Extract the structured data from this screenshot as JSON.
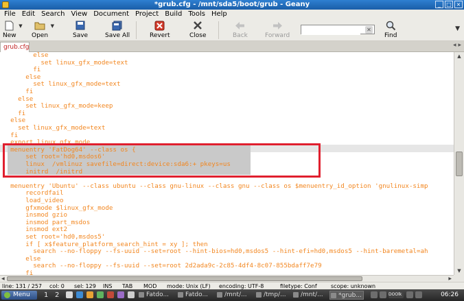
{
  "window": {
    "title": "*grub.cfg - /mnt/sda5/boot/grub - Geany",
    "buttons": [
      "_",
      "□",
      "×"
    ]
  },
  "menu": [
    "File",
    "Edit",
    "Search",
    "View",
    "Document",
    "Project",
    "Build",
    "Tools",
    "Help"
  ],
  "toolbar": {
    "new": "New",
    "open": "Open",
    "save": "Save",
    "save_all": "Save All",
    "revert": "Revert",
    "close": "Close",
    "back": "Back",
    "forward": "Forward",
    "search_value": "",
    "find": "Find"
  },
  "tabs": [
    {
      "label": "grub.cfg"
    }
  ],
  "editor": {
    "lines": [
      {
        "indent": "        ",
        "text": "else"
      },
      {
        "indent": "          ",
        "text": "set linux_gfx_mode=text"
      },
      {
        "indent": "        ",
        "text": "fi"
      },
      {
        "indent": "      ",
        "text": "else"
      },
      {
        "indent": "        ",
        "text": "set linux_gfx_mode=text"
      },
      {
        "indent": "      ",
        "text": "fi"
      },
      {
        "indent": "    ",
        "text": "else"
      },
      {
        "indent": "      ",
        "text": "set linux_gfx_mode=keep"
      },
      {
        "indent": "    ",
        "text": "fi"
      },
      {
        "indent": "  ",
        "text": "else"
      },
      {
        "indent": "    ",
        "text": "set linux_gfx_mode=text"
      },
      {
        "indent": "  ",
        "text": "fi"
      },
      {
        "indent": "  ",
        "text": "export linux_gfx_mode"
      },
      {
        "indent": "  ",
        "text": "menuentry 'FatDog64' --class os {"
      },
      {
        "indent": "      ",
        "text": "set root='hd0,msdos6'"
      },
      {
        "indent": "      ",
        "text": "linux  /vmlinuz savefile=direct:device:sda6:+ pkeys=us"
      },
      {
        "indent": "      ",
        "text": "initrd  /initrd"
      },
      {
        "indent": "",
        "text": ""
      },
      {
        "indent": "  ",
        "text": "menuentry 'Ubuntu' --class ubuntu --class gnu-linux --class gnu --class os $menuentry_id_option 'gnulinux-simp"
      },
      {
        "indent": "      ",
        "text": "recordfail"
      },
      {
        "indent": "      ",
        "text": "load_video"
      },
      {
        "indent": "      ",
        "text": "gfxmode $linux_gfx_mode"
      },
      {
        "indent": "      ",
        "text": "insmod gzio"
      },
      {
        "indent": "      ",
        "text": "insmod part_msdos"
      },
      {
        "indent": "      ",
        "text": "insmod ext2"
      },
      {
        "indent": "      ",
        "text": "set root='hd0,msdos5'"
      },
      {
        "indent": "      ",
        "text": "if [ x$feature_platform_search_hint = xy ]; then"
      },
      {
        "indent": "        ",
        "text": "search --no-floppy --fs-uuid --set=root --hint-bios=hd0,msdos5 --hint-efi=hd0,msdos5 --hint-baremetal=ah"
      },
      {
        "indent": "      ",
        "text": "else"
      },
      {
        "indent": "        ",
        "text": "search --no-floppy --fs-uuid --set=root 2d2ada9c-2c85-4df4-8c07-855bdaff7e79"
      },
      {
        "indent": "      ",
        "text": "fi"
      }
    ]
  },
  "status": {
    "line": "line: 131 / 257",
    "col": "col: 0",
    "sel": "sel: 129",
    "ins": "INS",
    "tab": "TAB",
    "mod": "MOD",
    "mode": "mode: Unix (LF)",
    "encoding": "encoding: UTF-8",
    "filetype": "filetype: Conf",
    "scope": "scope: unknown"
  },
  "taskbar": {
    "menu": "Menu",
    "ws1": "1",
    "ws2": "2",
    "tasks": [
      "Fatdo...",
      "Fatdo...",
      "/mnt/...",
      "/tmp/...",
      "/mnt/...",
      "*grub..."
    ],
    "clock": "06:26",
    "tray_text": "DOOlk"
  }
}
